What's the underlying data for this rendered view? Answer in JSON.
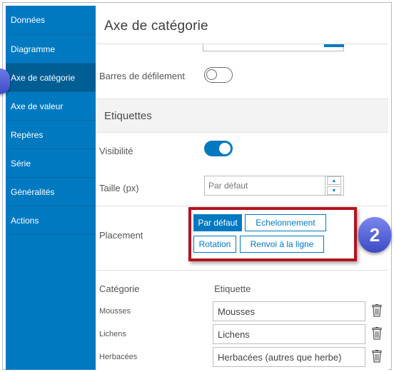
{
  "sidebar": {
    "items": [
      {
        "label": "Données"
      },
      {
        "label": "Diagramme"
      },
      {
        "label": "Axe de catégorie"
      },
      {
        "label": "Axe de valeur"
      },
      {
        "label": "Repères"
      },
      {
        "label": "Série"
      },
      {
        "label": "Généralités"
      },
      {
        "label": "Actions"
      }
    ],
    "active_index": 2
  },
  "header": {
    "title": "Axe de catégorie"
  },
  "scrollbars": {
    "label": "Barres de défilement",
    "enabled": false
  },
  "labels_section": {
    "title": "Etiquettes",
    "visibility": {
      "label": "Visibilité",
      "enabled": true
    },
    "size": {
      "label": "Taille (px)",
      "placeholder": "Par défaut",
      "value": ""
    },
    "placement": {
      "label": "Placement",
      "options": [
        "Par défaut",
        "Echelonnement",
        "Rotation",
        "Renvoi à la ligne"
      ],
      "selected": "Par défaut"
    }
  },
  "callout": {
    "number": "2"
  },
  "categories": {
    "header_category": "Catégorie",
    "header_label": "Etiquette",
    "rows": [
      {
        "category": "Mousses",
        "label": "Mousses"
      },
      {
        "category": "Lichens",
        "label": "Lichens"
      },
      {
        "category": "Herbacées",
        "label": "Herbacées (autres que herbe)"
      }
    ]
  },
  "colors": {
    "accent": "#0079c1",
    "callout": "#b3121f",
    "badge": "#4f5bd5"
  }
}
